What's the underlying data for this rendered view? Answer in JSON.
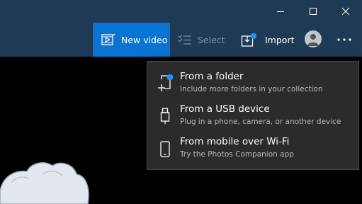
{
  "toolbar": {
    "new_video_label": "New video",
    "select_label": "Select",
    "import_label": "Import"
  },
  "import_menu": {
    "items": [
      {
        "title": "From a folder",
        "subtitle": "Include more folders in your collection",
        "icon": "add-folder-icon"
      },
      {
        "title": "From a USB device",
        "subtitle": "Plug in a phone, camera, or another device",
        "icon": "usb-icon"
      },
      {
        "title": "From mobile over Wi-Fi",
        "subtitle": "Try the Photos Companion app",
        "icon": "phone-icon"
      }
    ]
  },
  "colors": {
    "titlebar": "#1f3a55",
    "accent": "#0a74d2",
    "menu_bg": "#2b2b2b",
    "canvas": "#000000"
  }
}
